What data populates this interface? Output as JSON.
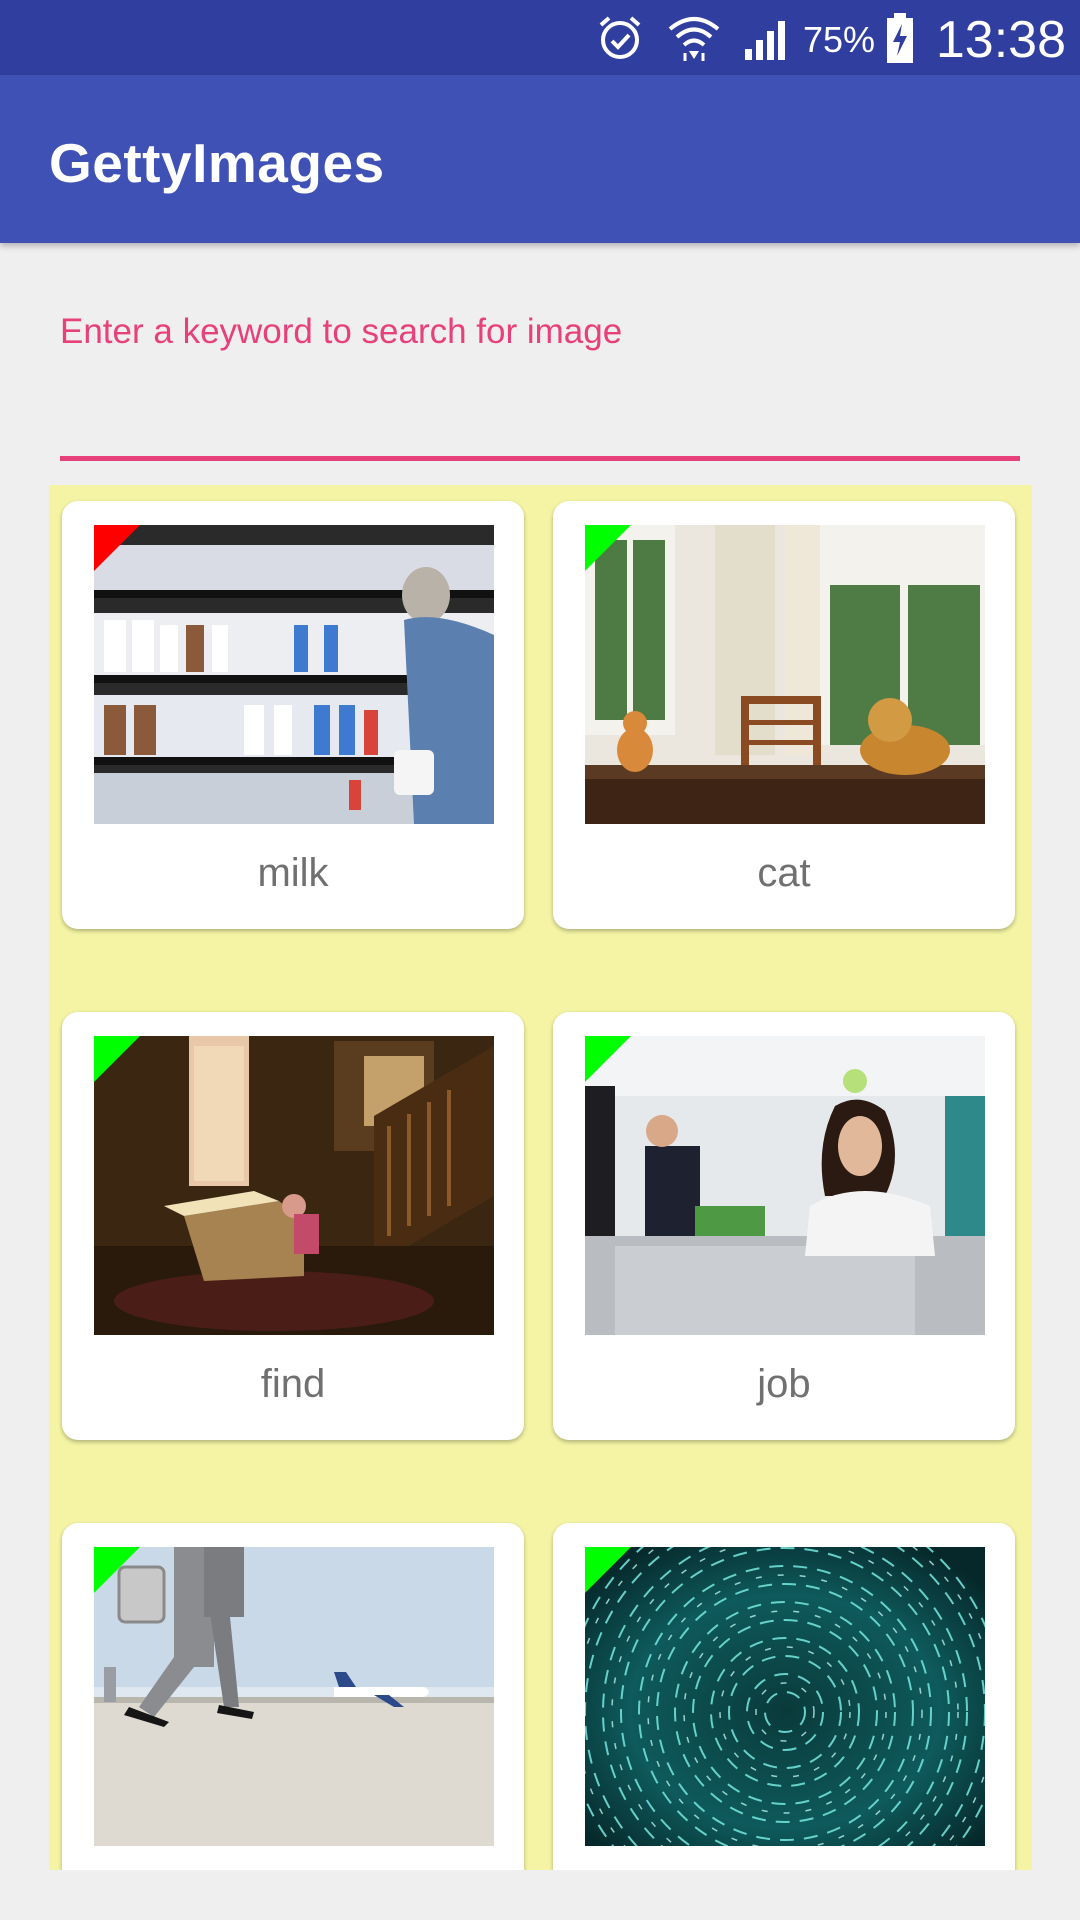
{
  "status_bar": {
    "battery_percent": "75%",
    "time": "13:38",
    "icons": [
      "alarm-icon",
      "wifi-icon",
      "signal-icon",
      "battery-charging-icon"
    ]
  },
  "app_bar": {
    "title": "GettyImages",
    "color": "#3f51b5"
  },
  "search": {
    "hint": "Enter a keyword to search for image",
    "value": "",
    "accent_color": "#e8407a"
  },
  "grid": {
    "background_color": "#f4f4a4",
    "cards": [
      {
        "label": "milk",
        "marker": "red",
        "image": "milk-aisle-image"
      },
      {
        "label": "cat",
        "marker": "green",
        "image": "cat-and-dog-image"
      },
      {
        "label": "find",
        "marker": "green",
        "image": "child-opening-box-image"
      },
      {
        "label": "job",
        "marker": "green",
        "image": "office-woman-image"
      },
      {
        "label": "",
        "marker": "green",
        "image": "airport-walker-image"
      },
      {
        "label": "",
        "marker": "green",
        "image": "star-trails-image"
      }
    ]
  }
}
